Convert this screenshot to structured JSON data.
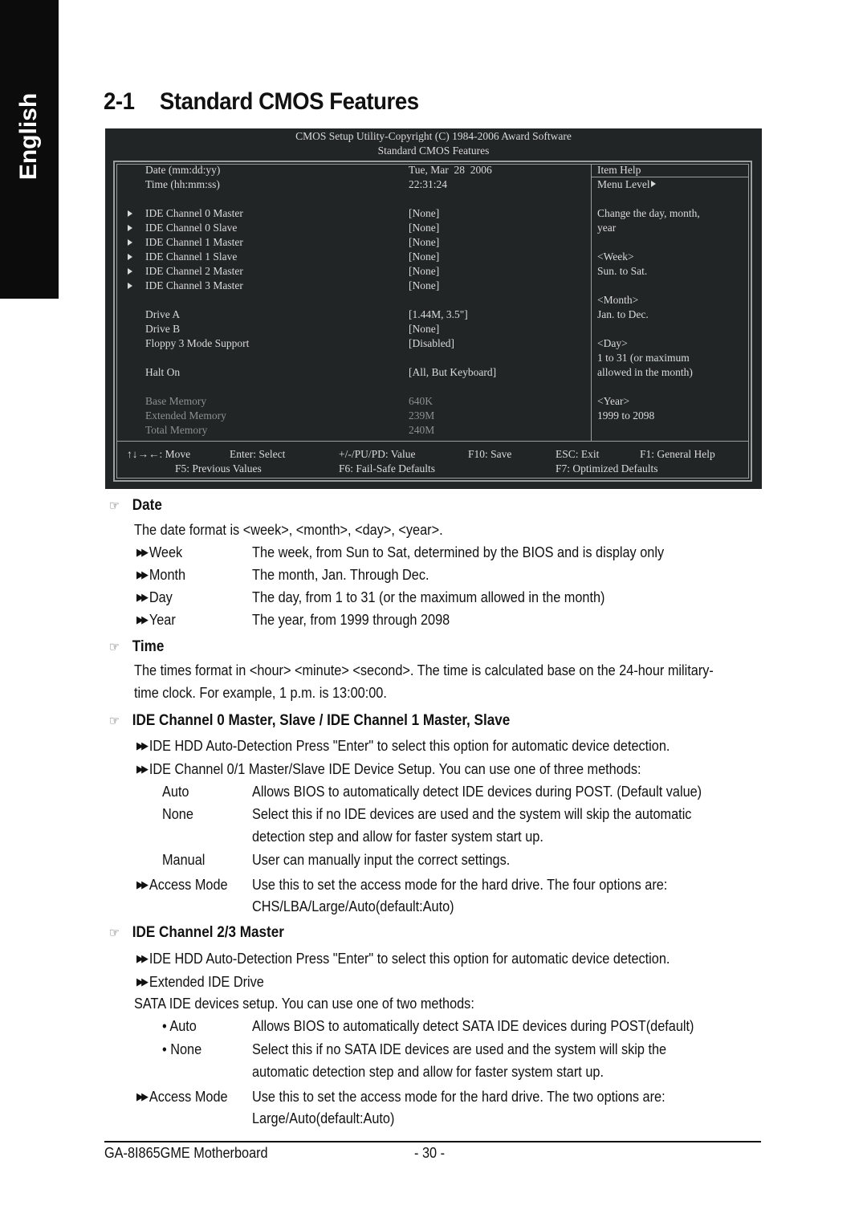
{
  "side_tab": {
    "label": "English"
  },
  "title": {
    "number": "2-1",
    "text": "Standard CMOS Features"
  },
  "bios": {
    "header_line1": "CMOS Setup Utility-Copyright (C) 1984-2006 Award Software",
    "header_line2": "Standard CMOS Features",
    "items": [
      {
        "label": "Date (mm:dd:yy)",
        "value": "Tue, Mar  28  2006",
        "submenu": false,
        "dimmed": false
      },
      {
        "label": "Time (hh:mm:ss)",
        "value": "22:31:24",
        "submenu": false,
        "dimmed": false
      },
      {
        "label": "IDE Channel 0 Master",
        "value": "[None]",
        "submenu": true,
        "dimmed": false
      },
      {
        "label": "IDE Channel 0 Slave",
        "value": "[None]",
        "submenu": true,
        "dimmed": false
      },
      {
        "label": "IDE Channel 1 Master",
        "value": "[None]",
        "submenu": true,
        "dimmed": false
      },
      {
        "label": "IDE Channel 1 Slave",
        "value": "[None]",
        "submenu": true,
        "dimmed": false
      },
      {
        "label": "IDE Channel 2 Master",
        "value": "[None]",
        "submenu": true,
        "dimmed": false
      },
      {
        "label": "IDE Channel 3 Master",
        "value": "[None]",
        "submenu": true,
        "dimmed": false
      },
      {
        "label": "Drive A",
        "value": "[1.44M, 3.5\"]",
        "submenu": false,
        "dimmed": false
      },
      {
        "label": "Drive B",
        "value": "[None]",
        "submenu": false,
        "dimmed": false
      },
      {
        "label": "Floppy 3 Mode Support",
        "value": "[Disabled]",
        "submenu": false,
        "dimmed": false
      },
      {
        "label": "Halt On",
        "value": "[All, But Keyboard]",
        "submenu": false,
        "dimmed": false
      },
      {
        "label": "Base Memory",
        "value": "640K",
        "submenu": false,
        "dimmed": true
      },
      {
        "label": "Extended Memory",
        "value": "239M",
        "submenu": false,
        "dimmed": true
      },
      {
        "label": "Total Memory",
        "value": "240M",
        "submenu": false,
        "dimmed": true
      }
    ],
    "help": {
      "title": "Item Help",
      "menu_level": "Menu Level",
      "lines": [
        "Change the day, month,",
        "year",
        "<Week>",
        "Sun. to Sat.",
        "<Month>",
        "Jan. to Dec.",
        "<Day>",
        "1 to 31 (or maximum",
        "allowed in the month)",
        "<Year>",
        "1999 to 2098"
      ]
    },
    "keys": {
      "move": "↑↓→←: Move",
      "enter": "Enter: Select",
      "value": "+/-/PU/PD: Value",
      "save": "F10: Save",
      "exit": "ESC: Exit",
      "help": "F1: General Help",
      "prev": "F5: Previous Values",
      "failsafe": "F6: Fail-Safe Defaults",
      "optimized": "F7: Optimized Defaults"
    }
  },
  "sections": {
    "date": {
      "heading": "Date",
      "intro": "The date format is <week>, <month>, <day>, <year>.",
      "items": [
        {
          "term": "Week",
          "desc": "The week, from Sun to Sat, determined by the BIOS and is display only"
        },
        {
          "term": "Month",
          "desc": "The month, Jan. Through Dec."
        },
        {
          "term": "Day",
          "desc": "The day, from 1 to 31 (or the maximum allowed in the month)"
        },
        {
          "term": "Year",
          "desc": "The year, from 1999 through 2098"
        }
      ]
    },
    "time": {
      "heading": "Time",
      "line1": "The times format in <hour> <minute> <second>. The time is calculated base on the 24-hour military-",
      "line2": "time clock. For example, 1 p.m. is 13:00:00."
    },
    "ide01": {
      "heading": "IDE Channel 0 Master, Slave / IDE Channel 1 Master, Slave",
      "bullet1": "IDE HDD Auto-Detection Press \"Enter\" to select this option for automatic device detection.",
      "bullet2": "IDE Channel 0/1 Master/Slave IDE Device Setup.  You can use one of three methods:",
      "methods": [
        {
          "term": "Auto",
          "desc": "Allows BIOS to automatically detect IDE devices during POST. (Default value)"
        },
        {
          "term": "None",
          "desc": "Select this if no IDE devices are used and the system will skip the automatic",
          "desc2": "detection step and allow for faster system start up."
        },
        {
          "term": "Manual",
          "desc": "User can manually input the correct settings."
        }
      ],
      "access_term": "Access Mode",
      "access_desc": "Use this to set the access mode for the hard drive. The four options are:",
      "access_desc2": "CHS/LBA/Large/Auto(default:Auto)"
    },
    "ide23": {
      "heading": "IDE Channel 2/3 Master",
      "bullet1": "IDE HDD Auto-Detection Press \"Enter\" to select this option for automatic device detection.",
      "bullet2": "Extended IDE Drive",
      "intro": "SATA IDE devices setup. You can use one of two methods:",
      "methods": [
        {
          "term": "Auto",
          "desc": "Allows BIOS to automatically detect SATA IDE devices during POST(default)"
        },
        {
          "term": "None",
          "desc": "Select this if no SATA IDE devices are used and the system will skip the",
          "desc2": "automatic detection step and allow for faster system start up."
        }
      ],
      "access_term": "Access Mode",
      "access_desc": "Use this to set the access mode for the hard drive. The two options are:",
      "access_desc2": "Large/Auto(default:Auto)"
    }
  },
  "footer": {
    "product": "GA-8I865GME Motherboard",
    "page": "- 30 -"
  }
}
